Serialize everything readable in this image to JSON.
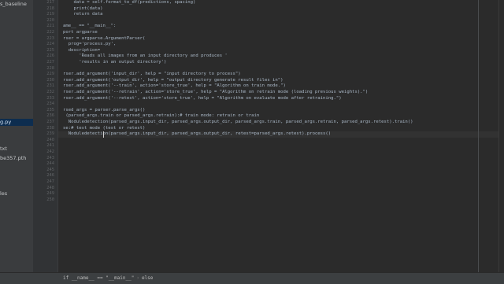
{
  "sidebar": {
    "items": [
      {
        "label": "s_baseline",
        "selected": false
      },
      {
        "label": "g.py",
        "selected": true
      },
      {
        "label": "txt",
        "selected": false
      },
      {
        "label": "be357.pth",
        "selected": false
      },
      {
        "label": "les",
        "selected": false
      }
    ]
  },
  "editor": {
    "line_numbers": [
      "217",
      "218",
      "219",
      "220",
      "221",
      "222",
      "223",
      "224",
      "225",
      "226",
      "227",
      "228",
      "229",
      "230",
      "231",
      "232",
      "233",
      "234",
      "235",
      "236",
      "237",
      "238",
      "239",
      "240",
      "241",
      "242",
      "243",
      "244",
      "245",
      "246",
      "247",
      "248",
      "249",
      "250"
    ],
    "lines": [
      "    data = self.format_to_df(predictions, spacing)",
      "    print(data)",
      "    return data",
      "",
      "ame__ == \"__main__\":",
      "port argparse",
      "rser = argparse.ArgumentParser(",
      "  prog='process.py',",
      "  description=",
      "      'Reads all images from an input directory and produces '",
      "      'results in an output directory')",
      "",
      "rser.add_argument('input_dir', help = \"input directory to process\")",
      "rser.add_argument('output_dir', help = \"output directory generate result files in\")",
      "rser.add_argument('--train', action='store_true', help = \"Algorithm on train mode.\")",
      "rser.add_argument('--retrain', action='store_true', help = \"Algorithm on retrain mode (loading previous weights).\")",
      "rser.add_argument('--retest', action='store_true', help = \"Algorithm on evaluate mode after retraining.\")",
      "",
      "rsed_args = parser.parse_args()",
      " (parsed_args.train or parsed_args.retrain):# train mode: retrain or train",
      "  Noduledetection(parsed_args.input_dir, parsed_args.output_dir, parsed_args.train, parsed_args.retrain, parsed_args.retest).train()",
      "se:# test mode (test or retest)",
      "  Noduledetection(parsed_args.input_dir, parsed_args.output_dir, retest=parsed_args.retest).process()",
      "",
      "",
      "",
      "",
      "",
      "",
      "",
      "",
      "",
      "",
      ""
    ],
    "current_line_index": 22
  },
  "status": {
    "breadcrumb_1": "if __name__ == \"__main__\"",
    "breadcrumb_2": "else"
  }
}
